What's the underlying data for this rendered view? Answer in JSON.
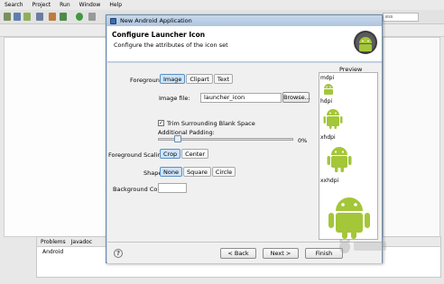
{
  "menubar": {
    "items": [
      "Search",
      "Project",
      "Run",
      "Window",
      "Help"
    ]
  },
  "quick_access": "ess",
  "bottom_panel": {
    "tabs": [
      "Problems",
      "Javadoc"
    ],
    "console_text": "Android"
  },
  "dialog": {
    "window_title": "New Android Application",
    "header_title": "Configure Launcher Icon",
    "header_subtitle": "Configure the attributes of the icon set",
    "foreground_label": "Foreground:",
    "foreground_options": [
      "Image",
      "Clipart",
      "Text"
    ],
    "foreground_selected": "Image",
    "image_file_label": "Image file:",
    "image_file_value": "launcher_icon",
    "browse_label": "Browse...",
    "trim_label": "Trim Surrounding Blank Space",
    "trim_checked": true,
    "padding_label": "Additional Padding:",
    "padding_value": "0%",
    "scaling_label": "Foreground Scaling:",
    "scaling_options": [
      "Crop",
      "Center"
    ],
    "scaling_selected": "Crop",
    "shape_label": "Shape",
    "shape_options": [
      "None",
      "Square",
      "Circle"
    ],
    "shape_selected": "None",
    "bgcolor_label": "Background Color:",
    "preview_label": "Preview",
    "preview_densities": [
      "mdpi",
      "hdpi",
      "xhdpi",
      "xxhdpi"
    ],
    "buttons": {
      "back": "< Back",
      "next": "Next >",
      "finish": "Finish"
    },
    "help_icon": "?"
  },
  "colors": {
    "android_green": "#a4c639",
    "active_blue": "#cde3f7"
  }
}
